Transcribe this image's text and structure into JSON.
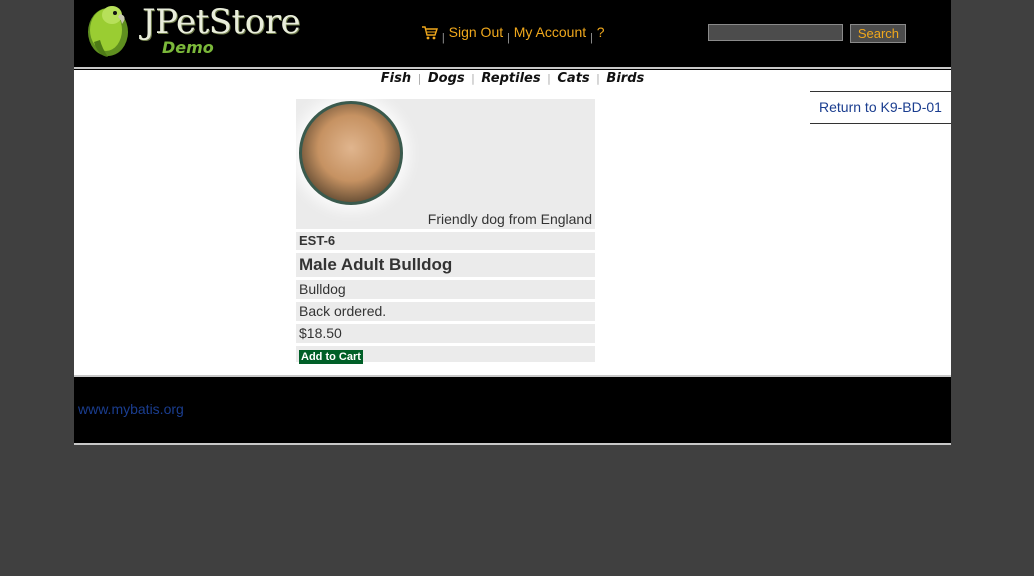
{
  "header": {
    "logo_title": "JPetStore",
    "logo_subtitle": "Demo",
    "menu": {
      "cart_icon": "cart-icon",
      "sign_out": "Sign Out",
      "my_account": "My Account",
      "help": "?",
      "separator": "|"
    },
    "search": {
      "placeholder": "",
      "value": "",
      "button_label": "Search"
    }
  },
  "quicklinks": {
    "items": [
      "Fish",
      "Dogs",
      "Reptiles",
      "Cats",
      "Birds"
    ],
    "separator": "|"
  },
  "back_link": "Return to K9-BD-01",
  "item": {
    "image_icon": "dog-photo",
    "description": "Friendly dog from England",
    "id": "EST-6",
    "name": "Male Adult Bulldog",
    "product": "Bulldog",
    "stock": "Back ordered.",
    "price": "$18.50",
    "add_to_cart": "Add to Cart"
  },
  "footer": {
    "link": "www.mybatis.org"
  },
  "colors": {
    "page_bg": "#404040",
    "header_bg": "#000000",
    "menu_link": "#f0a81c",
    "link_blue": "#1a3d8f",
    "row_bg": "#ebebeb",
    "cart_button": "#005f27"
  }
}
